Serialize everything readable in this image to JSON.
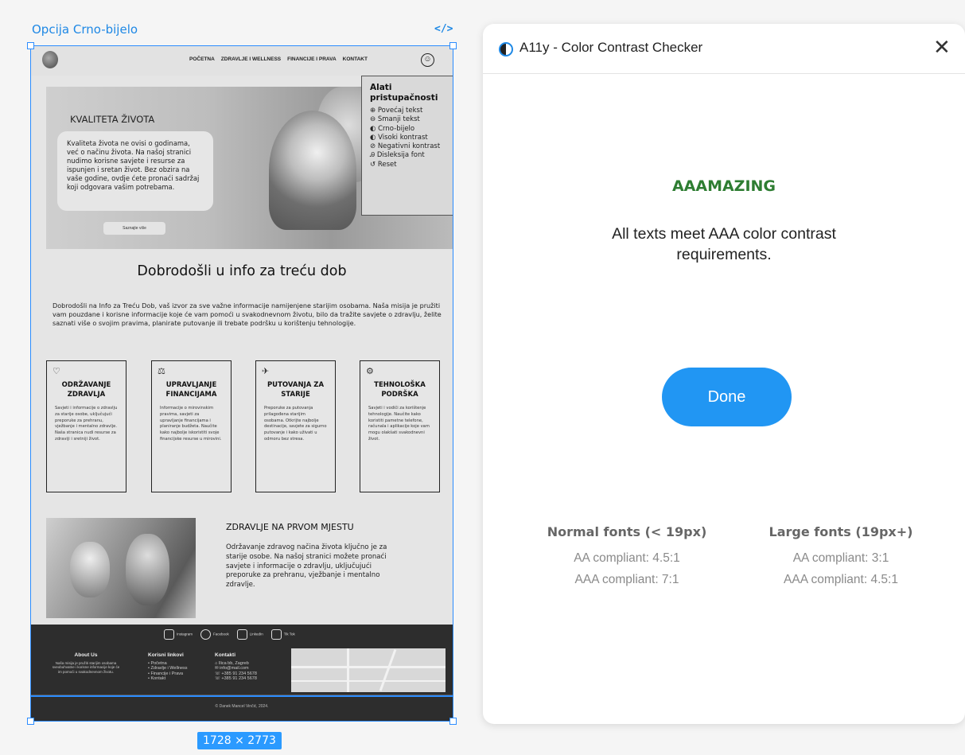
{
  "frame": {
    "label": "Opcija Crno-bijelo",
    "code_icon": "</>",
    "size": "1728 × 2773"
  },
  "site": {
    "nav": {
      "items": [
        "POČETNA",
        "ZDRAVLJE I WELLNESS",
        "FINANCIJE I PRAVA",
        "KONTAKT"
      ],
      "a11y_icon": "accessibility-icon"
    },
    "hero": {
      "title": "KVALITETA ŽIVOTA",
      "text": "Kvaliteta života ne ovisi o godinama, već o načinu života. Na našoj stranici nudimo korisne savjete i resurse za ispunjen i sretan život. Bez obzira na vaše godine, ovdje ćete pronaći sadržaj koji odgovara vašim potrebama.",
      "button": "Saznajte više"
    },
    "a11y_panel": {
      "title": "Alati pristupačnosti",
      "items": [
        "⊕ Povećaj tekst",
        "⊖ Smanji tekst",
        "◐ Crno-bijelo",
        "◐ Visoki kontrast",
        "⊘ Negativni kontrast",
        "Ꭿ Disleksija font",
        "↺ Reset"
      ]
    },
    "welcome": {
      "heading": "Dobrodošli u info za treću dob",
      "text": "Dobrodošli na Info za Treću Dob, vaš izvor za sve važne informacije namijenjene starijim osobama. Naša misija je pružiti vam pouzdane i korisne informacije koje će vam pomoći u svakodnevnom životu, bilo da tražite savjete o zdravlju, želite saznati više o svojim pravima, planirate putovanje ili trebate podršku u korištenju tehnologije."
    },
    "cards": [
      {
        "icon": "♡",
        "title": "ODRŽAVANJE ZDRAVLJA",
        "text": "Savjeti i informacije o zdravlju za starije osobe, uključujući preporuke za prehranu, vježbanje i mentalno zdravlje. Naša stranica nudi resurse za zdraviji i sretniji život."
      },
      {
        "icon": "⚖",
        "title": "UPRAVLJANJE FINANCIJAMA",
        "text": "Informacije o mirovinskim pravima, savjeti za upravljanje financijama i planiranje budžeta. Naučite kako najbolje iskoristiti svoje financijske resurse u mirovini."
      },
      {
        "icon": "✈",
        "title": "PUTOVANJA ZA STARIJE",
        "text": "Preporuke za putovanja prilagođena starijim osobama. Otkrijte najbolje destinacije, savjete za sigurno putovanje i kako uživati u odmoru bez stresa."
      },
      {
        "icon": "⚙",
        "title": "TEHNOLOŠKA PODRŠKA",
        "text": "Savjeti i vodiči za korištenje tehnologije. Naučite kako koristiti pametne telefone, računala i aplikacije koje vam mogu olakšati svakodnevni život."
      }
    ],
    "health": {
      "heading": "ZDRAVLJE NA PRVOM MJESTU",
      "text": "Održavanje zdravog načina života ključno je za starije osobe. Na našoj stranici možete pronaći savjete i informacije o zdravlju, uključujući preporuke za prehranu, vježbanje i mentalno zdravlje."
    },
    "footer": {
      "social": [
        "Instagram",
        "Facebook",
        "LinkedIn",
        "Tik Tok"
      ],
      "about_title": "About Us",
      "about_text": "Naša misija je pružiti starijim osobama sveobuhvatne i korisne informacije koje će im pomoći u svakodnevnom životu.",
      "links_title": "Korisni linkovi",
      "links": [
        "• Početna",
        "• Zdravlje i Wellness",
        "• Financije i Prava",
        "• Kontakt"
      ],
      "contact_title": "Kontakti",
      "contacts": [
        "⌂ Ilica bb, Zagreb",
        "✉ info@mail.com",
        "☏ +385 91 234 5678",
        "☏ +385 91 234 5678"
      ],
      "copyright": "© Danek Mancel Vinčić, 2024."
    }
  },
  "checker": {
    "title": "A11y - Color Contrast Checker",
    "verdict": "AAAMAZING",
    "message": "All texts meet AAA color contrast requirements.",
    "done_label": "Done",
    "normal": {
      "title": "Normal fonts (< 19px)",
      "aa": "AA compliant: 4.5:1",
      "aaa": "AAA compliant: 7:1"
    },
    "large": {
      "title": "Large fonts (19px+)",
      "aa": "AA compliant: 3:1",
      "aaa": "AAA compliant: 4.5:1"
    },
    "colors": {
      "accent": "#2196f3",
      "verdict": "#2e7d32",
      "selection": "#2b8cff"
    }
  }
}
